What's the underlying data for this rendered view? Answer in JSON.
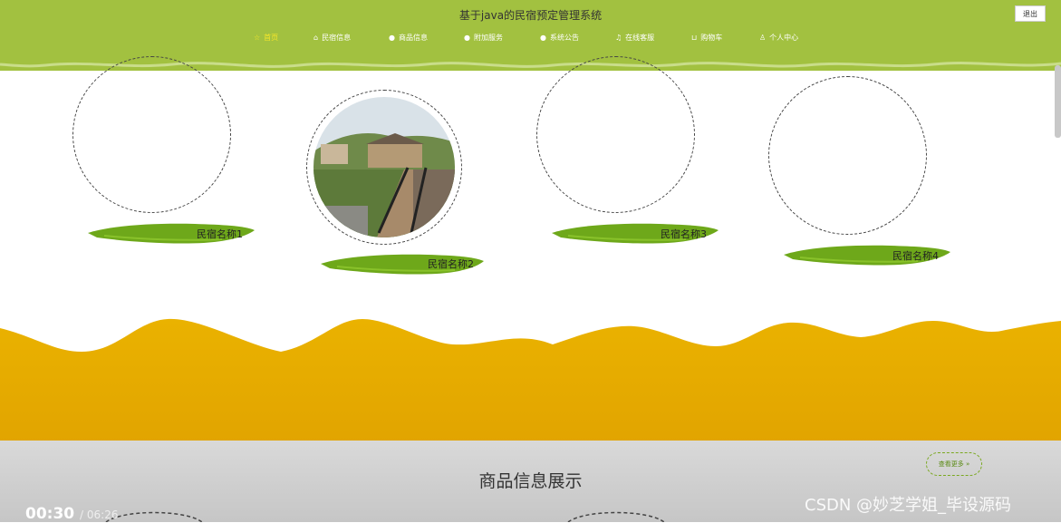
{
  "site": {
    "title": "基于java的民宿预定管理系统",
    "logout_label": "退出"
  },
  "nav": [
    {
      "label": "首页",
      "icon": "star-icon",
      "active": true
    },
    {
      "label": "民宿信息",
      "icon": "home-icon"
    },
    {
      "label": "商品信息",
      "icon": "dot-icon"
    },
    {
      "label": "附加服务",
      "icon": "dot-icon"
    },
    {
      "label": "系统公告",
      "icon": "dot-icon"
    },
    {
      "label": "在线客服",
      "icon": "headset-icon"
    },
    {
      "label": "购物车",
      "icon": "cart-icon"
    },
    {
      "label": "个人中心",
      "icon": "user-icon"
    }
  ],
  "cards": [
    {
      "name": "民宿名称1"
    },
    {
      "name": "民宿名称2"
    },
    {
      "name": "民宿名称3"
    },
    {
      "name": "民宿名称4"
    }
  ],
  "products": {
    "title": "商品信息展示",
    "more_label": "查看更多 »"
  },
  "video": {
    "current_time": "00:30",
    "total_time": "/ 06:26"
  },
  "watermark": "CSDN @妙芝学姐_毕设源码",
  "colors": {
    "header": "#a2c140",
    "brush": "#6ea81a",
    "wave": "#eab200",
    "active_nav": "#f5e629"
  }
}
